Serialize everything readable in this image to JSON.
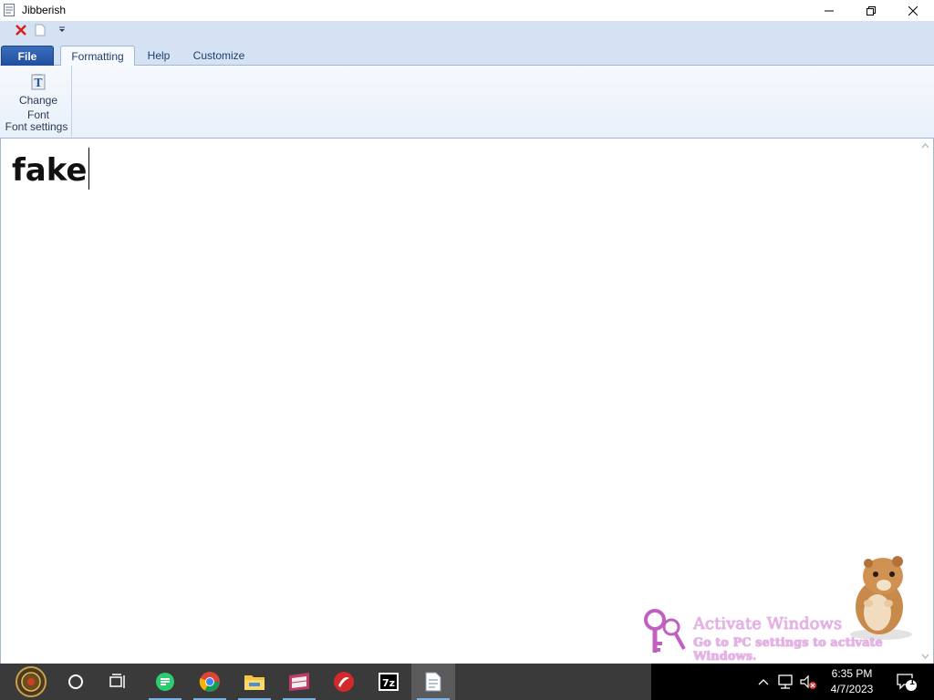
{
  "window": {
    "title": "Jibberish",
    "controls": [
      "minimize",
      "restore",
      "close"
    ]
  },
  "quick_access_toolbar": {
    "items": [
      "close-red-x-icon",
      "new-document-icon",
      "customize-dropdown-icon"
    ]
  },
  "ribbon": {
    "tabs": [
      {
        "label": "File",
        "state": "application-menu"
      },
      {
        "label": "Formatting",
        "state": "selected"
      },
      {
        "label": "Help",
        "state": "normal"
      },
      {
        "label": "Customize",
        "state": "normal"
      }
    ],
    "groups": [
      {
        "label": "Font settings",
        "buttons": [
          {
            "label_line1": "Change",
            "label_line2": "Font",
            "icon": "change-font-icon"
          }
        ]
      }
    ]
  },
  "editor": {
    "text": "fake"
  },
  "watermark": {
    "line1": "Activate Windows",
    "line2": "Go to PC settings to activate Windows."
  },
  "taskbar": {
    "apps": [
      "start-icon",
      "cortana-search-icon",
      "task-view-icon",
      "notes-app-icon",
      "chrome-icon",
      "file-explorer-icon",
      "media-app-icon",
      "red-app-icon",
      "7zip-icon",
      "jibberish-app-icon"
    ],
    "clock_time": "6:35 PM",
    "clock_date": "4/7/2023",
    "notification_count": "1"
  },
  "colors": {
    "ribbon_bg": "#d5e2f3",
    "file_tab": "#2a5aa8",
    "taskbar": "#3a3a3a",
    "watermark": "#e8b4e8"
  }
}
